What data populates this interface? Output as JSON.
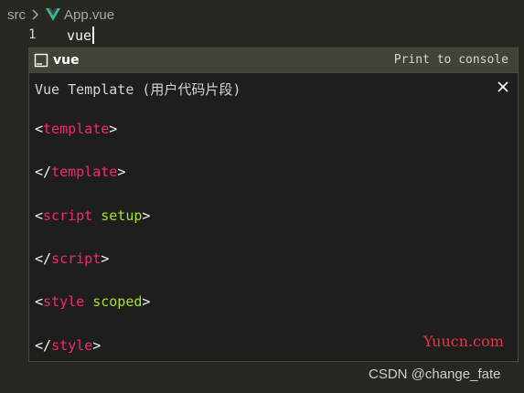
{
  "breadcrumb": {
    "folder": "src",
    "separator_icon": "chevron-right-icon",
    "file_icon": "vue-logo-icon",
    "file": "App.vue"
  },
  "editor": {
    "line_number": "1",
    "code": "vue"
  },
  "suggestion": {
    "icon": "snippet-icon",
    "label": "vue",
    "detail": "Print to console"
  },
  "details": {
    "title": "Vue Template (用户代码片段)",
    "close_icon": "close-icon",
    "lines": [
      {
        "open": "<",
        "tag": "template",
        "attr": "",
        "close": ">"
      },
      {
        "open": "</",
        "tag": "template",
        "attr": "",
        "close": ">"
      },
      {
        "open": "<",
        "tag": "script",
        "attr": " setup",
        "close": ">"
      },
      {
        "open": "</",
        "tag": "script",
        "attr": "",
        "close": ">"
      },
      {
        "open": "<",
        "tag": "style",
        "attr": " scoped",
        "close": ">"
      },
      {
        "open": "</",
        "tag": "style",
        "attr": "",
        "close": ">"
      }
    ]
  },
  "watermarks": {
    "site": "Yuucn.com",
    "author": "CSDN @change_fate"
  },
  "colors": {
    "editor_bg": "#272822",
    "widget_bg": "#1e1f1c",
    "selected_row": "#414339",
    "tag": "#f92672",
    "attribute": "#a6e22e",
    "vue_green": "#41b883",
    "watermark_red": "#e8334a"
  }
}
